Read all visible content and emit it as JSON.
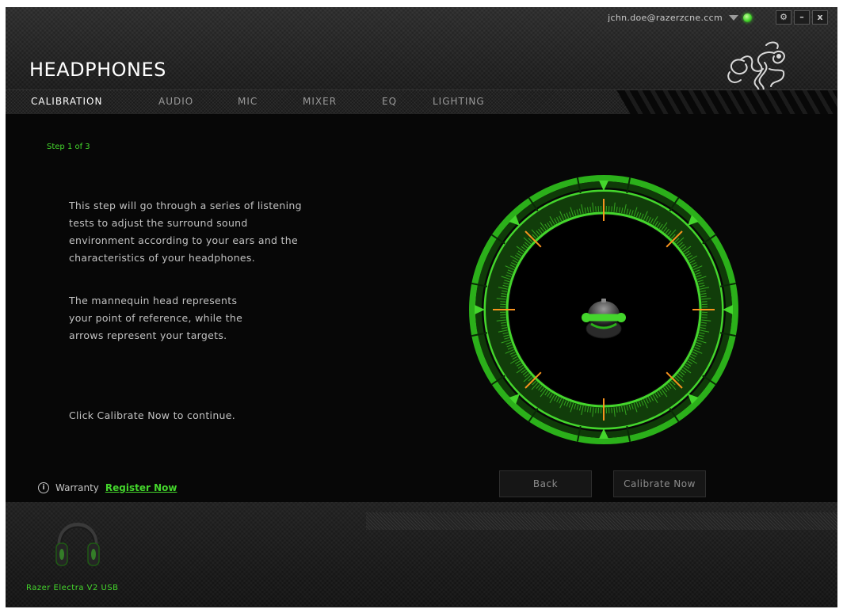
{
  "window": {
    "account_email": "jchn.doe@razerzcne.ccm",
    "controls": {
      "settings": "⚙",
      "minimize": "–",
      "close": "x"
    },
    "title": "HEADPHONES"
  },
  "tabs": [
    {
      "label": "CALIBRATION",
      "active": true
    },
    {
      "label": "AUDIO",
      "active": false
    },
    {
      "label": "MIC",
      "active": false
    },
    {
      "label": "MIXER",
      "active": false
    },
    {
      "label": "EQ",
      "active": false
    },
    {
      "label": "LIGHTING",
      "active": false
    }
  ],
  "calibration": {
    "step_label": "Step 1 of 3",
    "paragraph1": "This step will go through a series of listening tests to adjust the surround sound environment according to your ears and the characteristics of your headphones.",
    "paragraph2": "The mannequin head represents your point of reference, while the arrows represent your targets.",
    "paragraph3": "Click Calibrate Now to continue.",
    "buttons": {
      "back": "Back",
      "calibrate": "Calibrate Now"
    }
  },
  "warranty": {
    "info_icon": "i",
    "label": "Warranty",
    "link": "Register Now"
  },
  "device": {
    "name": "Razer Electra V2 USB"
  },
  "colors": {
    "accent": "#44d62c",
    "marker": "#f7931e",
    "background": "#070707"
  },
  "icons": {
    "status": "status-dot-icon",
    "dropdown": "chevron-down-icon",
    "settings": "gear-icon",
    "minimize": "minimize-icon",
    "close": "close-icon",
    "logo": "razer-snake-logo",
    "info": "info-icon",
    "head": "mannequin-head-icon",
    "device": "headphones-icon"
  }
}
